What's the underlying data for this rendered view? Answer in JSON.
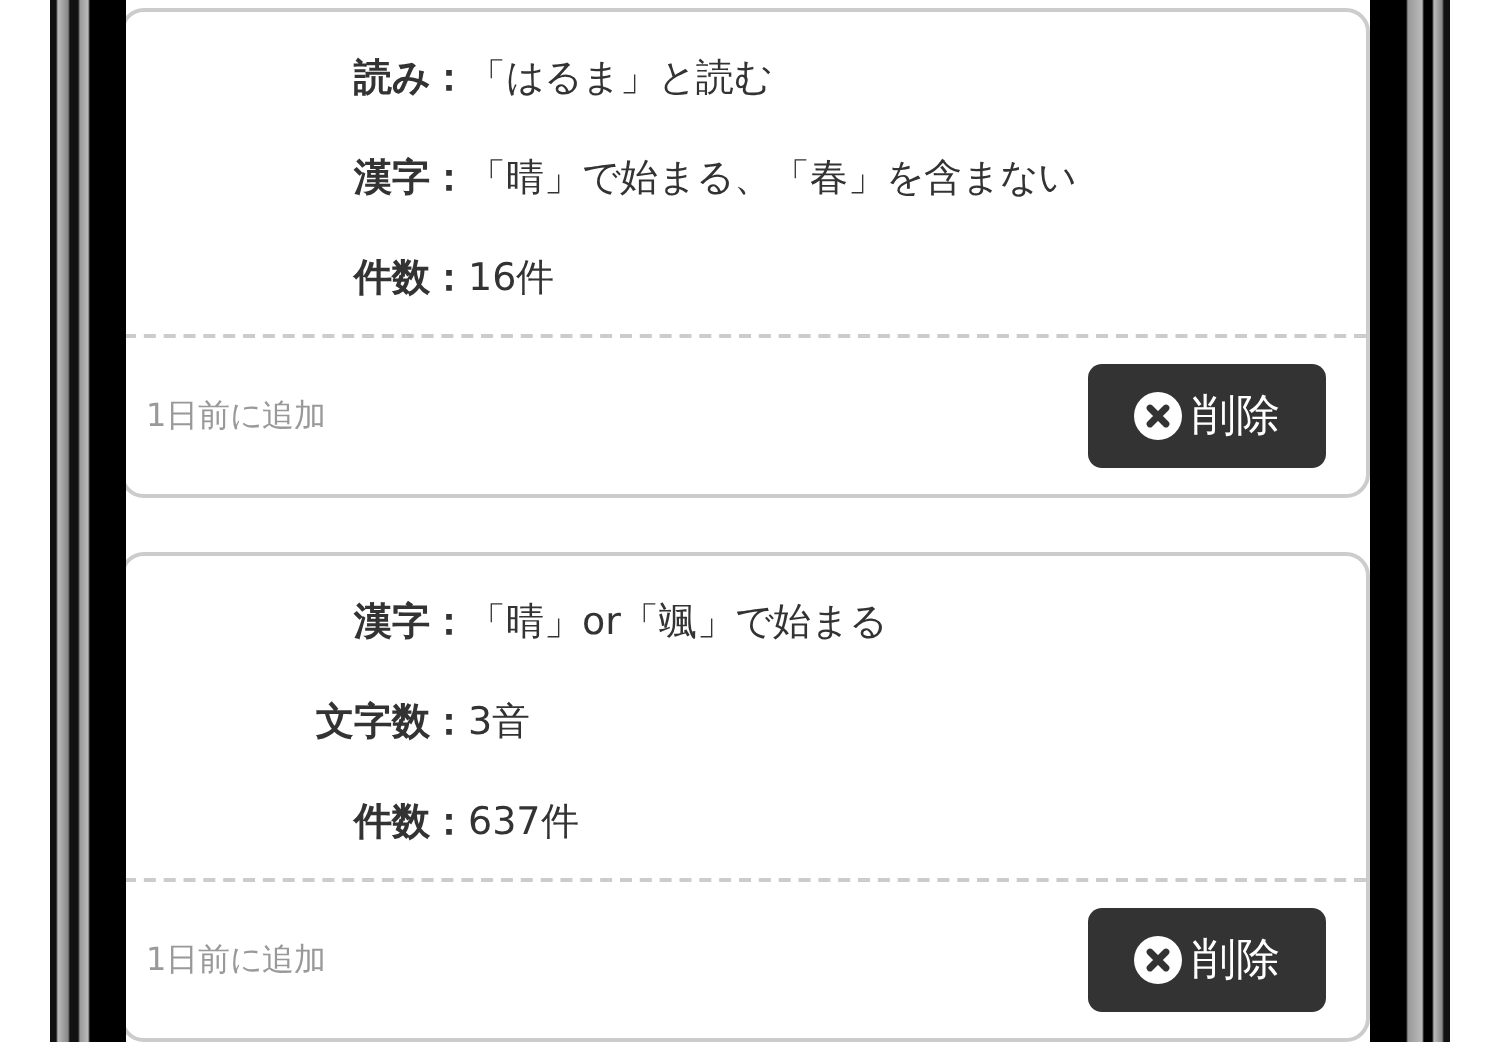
{
  "cards": [
    {
      "conditions": [
        {
          "label": "読み：",
          "value": "「はるま」と読む"
        },
        {
          "label": "漢字：",
          "value": "「晴」で始まる、「春」を含まない"
        },
        {
          "label": "件数：",
          "value": "16件"
        }
      ],
      "added": "1日前に追加",
      "delete_button": "削除"
    },
    {
      "conditions": [
        {
          "label": "漢字：",
          "value": "「晴」or「颯」で始まる"
        },
        {
          "label": "文字数：",
          "value": "3音"
        },
        {
          "label": "件数：",
          "value": "637件"
        }
      ],
      "added": "1日前に追加",
      "delete_button": "削除"
    }
  ]
}
